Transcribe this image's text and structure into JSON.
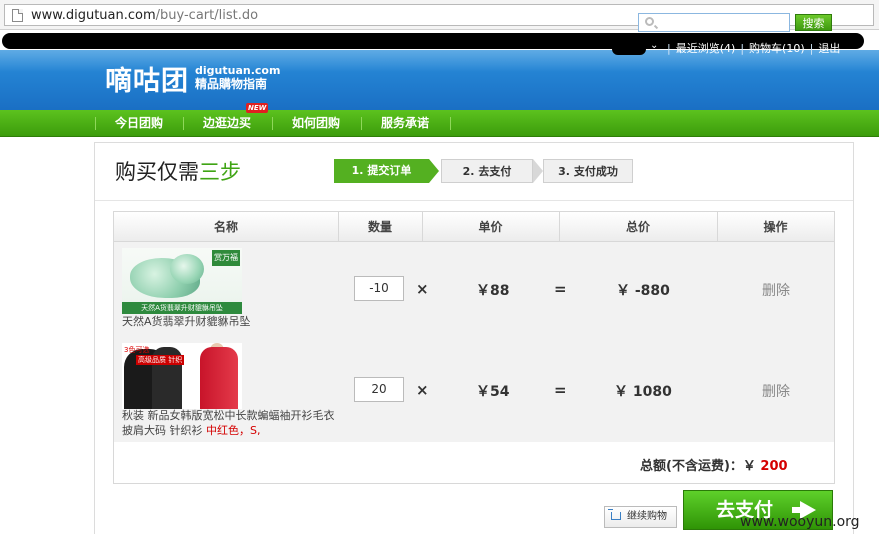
{
  "browser": {
    "url_host": "www.digutuan.com",
    "url_path": "/buy-cart/list.do"
  },
  "header": {
    "logo_cn": "嘀咕团",
    "logo_en": "digutuan.com",
    "logo_sub": "精品購物指南",
    "search_placeholder": "",
    "search_button": "搜索",
    "user_arrow": "⌄",
    "links": [
      "最近浏览(4)",
      "购物车(10)",
      "退出"
    ]
  },
  "nav": {
    "items": [
      "今日团购",
      "边逛边买",
      "如何团购",
      "服务承诺"
    ],
    "new_badge": "NEW"
  },
  "page": {
    "title_prefix": "购买仅需",
    "title_highlight": "三步",
    "steps": [
      "1. 提交订单",
      "2. 去支付",
      "3. 支付成功"
    ],
    "active_step": 1
  },
  "cart": {
    "columns": [
      "名称",
      "数量",
      "单价",
      "总价",
      "操作"
    ],
    "rows": [
      {
        "thumb_tag": "赏万福",
        "thumb_band": "天然A货翡翠升财貔貅吊坠",
        "name_line1": "天然A货翡翠升财貔貅吊坠",
        "name_line2": "",
        "name_variant": "",
        "qty": "-10",
        "times": "×",
        "unit_price": "￥88",
        "equals": "=",
        "total": "￥ -880",
        "action": "删除"
      },
      {
        "thumb_tag": "3色可选",
        "thumb_band": "高级品质 针织",
        "name_line1": "秋装 新品女韩版宽松中长款蝙蝠袖开衫毛衣",
        "name_line2": "披肩大码 针织衫",
        "name_variant": "中红色，S,",
        "qty": "20",
        "times": "×",
        "unit_price": "￥54",
        "equals": "=",
        "total": "￥ 1080",
        "action": "删除"
      }
    ],
    "total_label": "总额(不含运费)：￥",
    "total_amount": "200"
  },
  "actions": {
    "continue_label": "继续购物",
    "pay_label": "去支付"
  },
  "watermark": "www.wooyun.org",
  "colors": {
    "header_blue": "#1a6fc4",
    "nav_green": "#3c9c0c",
    "accent_green": "#54b021",
    "price_red": "#d40000"
  }
}
